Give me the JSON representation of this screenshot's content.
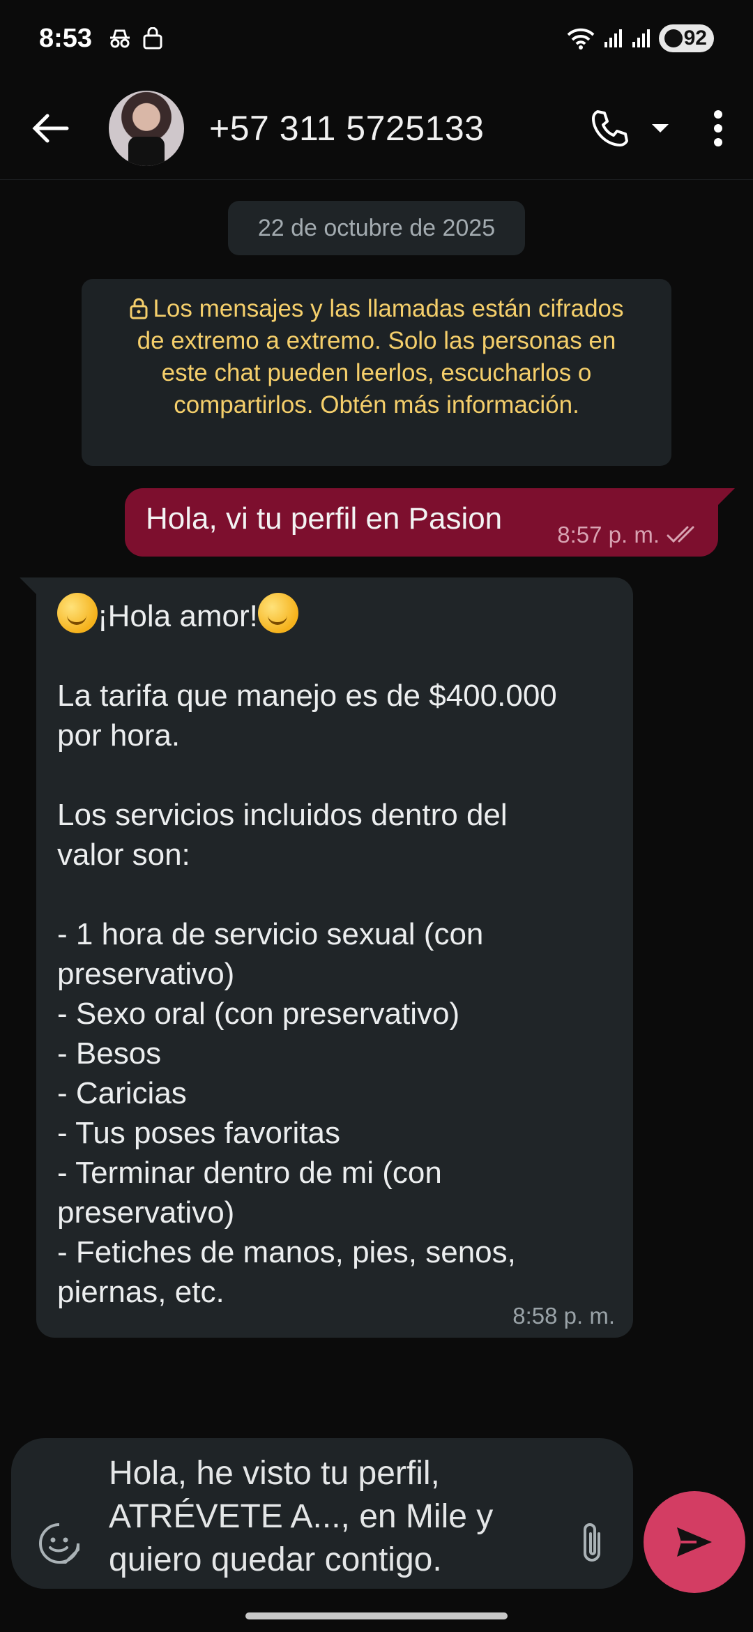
{
  "status_bar": {
    "time": "8:53",
    "battery": "92"
  },
  "header": {
    "contact": "+57 311 5725133"
  },
  "chat": {
    "date": "22 de octubre de 2025",
    "encryption_text": "Los mensajes y las llamadas están cifrados de extremo a extremo. Solo las personas en este chat pueden leerlos, escucharlos o compartirlos. Obtén más información.",
    "outgoing": {
      "text": "Hola, vi tu perfil en Pasion",
      "time": "8:57 p. m."
    },
    "incoming": {
      "greeting": "¡Hola amor!",
      "lines": [
        "",
        "La tarifa que manejo es de $400.000",
        "por hora.",
        "",
        "Los servicios incluidos dentro del",
        "valor son:",
        "",
        "- 1 hora de servicio sexual (con",
        "preservativo)",
        "- Sexo oral (con preservativo)",
        "- Besos",
        "- Caricias",
        "- Tus poses favoritas",
        "- Terminar dentro de mi (con",
        "preservativo)",
        "- Fetiches de manos, pies, senos,",
        "piernas, etc."
      ],
      "time": "8:58 p. m."
    }
  },
  "composer": {
    "value": "Hola, he visto tu perfil, ATRÉVETE A..., en Mile y quiero quedar contigo."
  },
  "colors": {
    "outgoing_bubble": "#7d0f2e",
    "send_button": "#d33d63",
    "notice_text": "#f5cf6b"
  }
}
